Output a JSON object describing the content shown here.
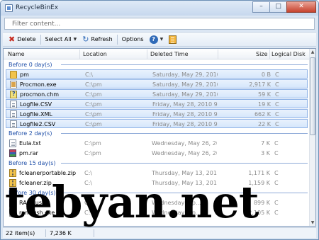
{
  "window": {
    "title": "RecycleBinEx"
  },
  "filter": {
    "placeholder": "Filter content..."
  },
  "toolbar": {
    "delete_label": "Delete",
    "select_all_label": "Select All",
    "refresh_label": "Refresh",
    "options_label": "Options"
  },
  "columns": [
    "Name",
    "Location",
    "Deleted Time",
    "Size",
    "Logical Disk"
  ],
  "groups": [
    {
      "label": "Before 0 day(s)"
    },
    {
      "label": "Before 2 day(s)"
    },
    {
      "label": "Before 15 day(s)"
    },
    {
      "label": "Before 30 day(s)"
    }
  ],
  "rows": [
    {
      "icon": "folder-icon",
      "name": "pm",
      "location": "C:\\",
      "deleted": "Saturday, May 29, 2010 ...",
      "size": "0 B",
      "disk": "C",
      "selected": true
    },
    {
      "icon": "exe-icon",
      "name": "Procmon.exe",
      "location": "C:\\pm",
      "deleted": "Saturday, May 29, 2010 ...",
      "size": "2,917 K",
      "disk": "C",
      "selected": true
    },
    {
      "icon": "help-file-icon",
      "name": "procmon.chm",
      "location": "C:\\pm",
      "deleted": "Saturday, May 29, 2010 ...",
      "size": "59 K",
      "disk": "C",
      "selected": true
    },
    {
      "icon": "csv-file-icon",
      "name": "Logfile.CSV",
      "location": "C:\\pm",
      "deleted": "Friday, May 28, 2010 9:...",
      "size": "19 K",
      "disk": "C",
      "selected": true
    },
    {
      "icon": "xml-file-icon",
      "name": "Logfile.XML",
      "location": "C:\\pm",
      "deleted": "Friday, May 28, 2010 9:...",
      "size": "662 K",
      "disk": "C",
      "selected": true
    },
    {
      "icon": "csv-file-icon",
      "name": "Logfile2.CSV",
      "location": "C:\\pm",
      "deleted": "Friday, May 28, 2010 9:...",
      "size": "22 K",
      "disk": "C",
      "selected": true
    },
    {
      "icon": "text-file-icon",
      "name": "Eula.txt",
      "location": "C:\\pm",
      "deleted": "Wednesday, May 26, 201...",
      "size": "7 K",
      "disk": "C",
      "selected": false
    },
    {
      "icon": "rar-archive-icon",
      "name": "pm.rar",
      "location": "C:\\pm",
      "deleted": "Wednesday, May 26, 201...",
      "size": "3 K",
      "disk": "C",
      "selected": false
    },
    {
      "icon": "zip-archive-icon",
      "name": "fcleanerportable.zip",
      "location": "C:\\",
      "deleted": "Thursday, May 13, 2010 ...",
      "size": "1,171 K",
      "disk": "C",
      "selected": false
    },
    {
      "icon": "zip-archive-icon",
      "name": "fcleaner.zip",
      "location": "C:\\",
      "deleted": "Thursday, May 13, 2010 ...",
      "size": "1,159 K",
      "disk": "C",
      "selected": false
    },
    {
      "icon": "rar-archive-icon",
      "name": "RAMRush",
      "location": "C:\\",
      "deleted": "Wednesday, Ap...",
      "size": "899 K",
      "disk": "C",
      "selected": false
    },
    {
      "icon": "exe-icon",
      "name": "ramrush.exe",
      "location": "C:\\",
      "deleted": "Wednesday, Ap...",
      "size": "2,105 K",
      "disk": "C",
      "selected": false
    }
  ],
  "status": {
    "count": "22 item(s)",
    "size": "7,236 K"
  },
  "watermark": "tebyan.net"
}
